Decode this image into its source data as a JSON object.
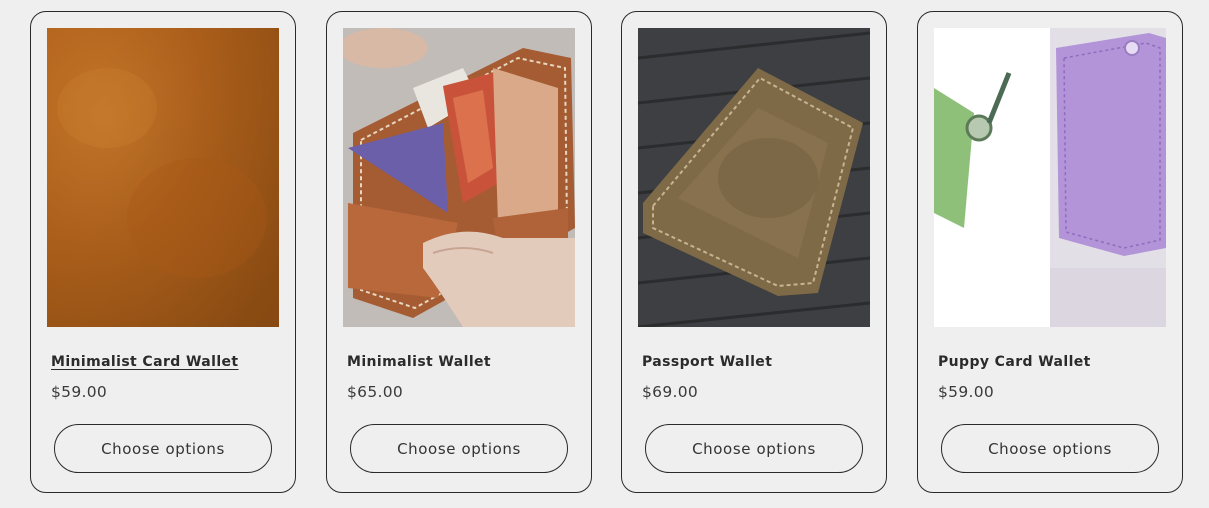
{
  "products": [
    {
      "title": "Minimalist Card Wallet",
      "price": "$59.00",
      "button_label": "Choose options",
      "image": "tan-leather-texture"
    },
    {
      "title": "Minimalist Wallet",
      "price": "$65.00",
      "button_label": "Choose options",
      "image": "open-brown-leather-wallet-in-hands"
    },
    {
      "title": "Passport Wallet",
      "price": "$69.00",
      "button_label": "Choose options",
      "image": "olive-leather-passport-wallet"
    },
    {
      "title": "Puppy Card Wallet",
      "price": "$59.00",
      "button_label": "Choose options",
      "image": "lavender-card-wallet-with-green-keyring"
    }
  ],
  "colors": {
    "background": "#efefef",
    "border": "#2a2a2a",
    "text": "#2b2b2b"
  }
}
